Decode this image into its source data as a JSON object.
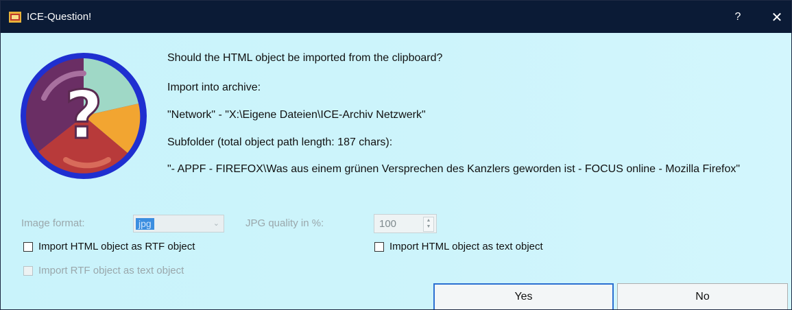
{
  "window": {
    "title": "ICE-Question!",
    "help_label": "?",
    "close_label": "✕"
  },
  "message": {
    "question": "Should the HTML object be imported from the clipboard?",
    "archive_label": "Import into archive:",
    "archive_path": "\"Network\"  -  \"X:\\Eigene Dateien\\ICE-Archiv Netzwerk\"",
    "subfolder_label": "Subfolder (total object path length: 187 chars):",
    "subfolder_path": "\"- APPF - FIREFOX\\Was aus einem grünen Versprechen des Kanzlers geworden ist - FOCUS online - Mozilla Firefox\""
  },
  "options": {
    "image_format_label": "Image format:",
    "image_format_value": "jpg",
    "jpg_quality_label": "JPG quality in %:",
    "jpg_quality_value": "100",
    "import_rtf_label": "Import HTML object as RTF object",
    "import_text_label": "Import HTML object as text object",
    "import_rtf_text_label": "Import RTF object as text object"
  },
  "buttons": {
    "yes": "Yes",
    "no": "No"
  },
  "icons": {
    "app": "app-icon",
    "question": "question-icon"
  },
  "colors": {
    "titlebar": "#0b1b36",
    "background": "#cdf4fb",
    "accent": "#2a6fd1"
  }
}
